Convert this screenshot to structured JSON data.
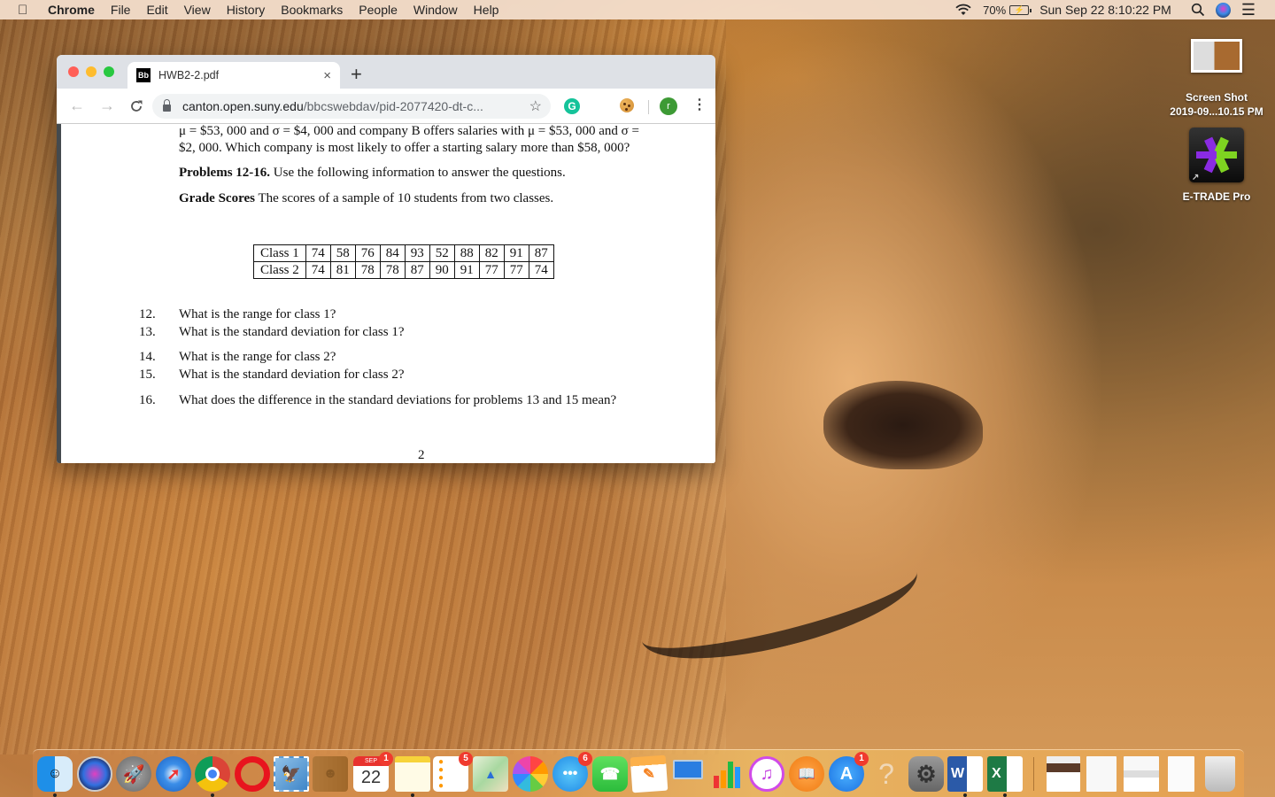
{
  "menubar": {
    "apple_icon": "apple-logo-icon",
    "app_name": "Chrome",
    "menus": [
      "File",
      "Edit",
      "View",
      "History",
      "Bookmarks",
      "People",
      "Window",
      "Help"
    ],
    "battery_percent": "70%",
    "datetime": "Sun Sep 22  8:10:22 PM",
    "status_icons": [
      "wifi-icon",
      "battery-charging-icon",
      "spotlight-search-icon",
      "siri-icon",
      "notification-center-icon"
    ]
  },
  "browser": {
    "tab": {
      "favicon_text": "Bb",
      "title": "HWB2-2.pdf",
      "close_glyph": "×"
    },
    "new_tab_glyph": "+",
    "nav": {
      "back": "←",
      "forward": "→",
      "reload": "C"
    },
    "url": {
      "host": "canton.open.suny.edu",
      "path": "/bbcswebdav/pid-2077420-dt-c..."
    },
    "bookmark_glyph": "☆",
    "extensions": [
      "grammarly-icon",
      "cookie-icon"
    ],
    "grammarly_letter": "G",
    "profile_initial": "r",
    "menu_glyph": "⋮"
  },
  "document": {
    "line1_prefix": "μ = $53, 000 and σ = $4, 000 and company B offers salaries with μ = $53, 000 and σ =",
    "line2": "$2, 000. Which company is most likely to offer a starting salary more than $58, 000?",
    "problems_heading": "Problems 12-16.",
    "problems_text": " Use the following information to answer the questions.",
    "grade_heading": "Grade Scores",
    "grade_text": " The scores of a sample of 10 students from two classes.",
    "table": {
      "rows": [
        {
          "label": "Class 1",
          "values": [
            "74",
            "58",
            "76",
            "84",
            "93",
            "52",
            "88",
            "82",
            "91",
            "87"
          ]
        },
        {
          "label": "Class 2",
          "values": [
            "74",
            "81",
            "78",
            "78",
            "87",
            "90",
            "91",
            "77",
            "77",
            "74"
          ]
        }
      ]
    },
    "questions": [
      {
        "num": "12.",
        "text": "What is the range for class 1?"
      },
      {
        "num": "13.",
        "text": "What is the standard deviation for class 1?"
      },
      {
        "num": "14.",
        "text": "What is the range for class 2?"
      },
      {
        "num": "15.",
        "text": "What is the standard deviation for class 2?"
      },
      {
        "num": "16.",
        "text": "What does the difference in the standard deviations for problems 13 and 15 mean?"
      }
    ],
    "page_number": "2"
  },
  "desktop": {
    "icons": [
      {
        "name": "screenshot-file",
        "label_line1": "Screen Shot",
        "label_line2": "2019-09...10.15 PM"
      },
      {
        "name": "etrade-pro-app",
        "label_line1": "E-TRADE Pro",
        "label_line2": ""
      }
    ]
  },
  "dock": {
    "items": [
      {
        "name": "finder",
        "running": true
      },
      {
        "name": "siri",
        "running": false
      },
      {
        "name": "launchpad",
        "running": false
      },
      {
        "name": "safari",
        "running": false
      },
      {
        "name": "chrome",
        "running": true
      },
      {
        "name": "opera",
        "running": false
      },
      {
        "name": "mail",
        "running": false
      },
      {
        "name": "contacts",
        "running": false
      },
      {
        "name": "calendar",
        "running": false,
        "badge": "1",
        "month": "SEP",
        "day": "22"
      },
      {
        "name": "notes",
        "running": true
      },
      {
        "name": "reminders",
        "running": false,
        "badge": "5"
      },
      {
        "name": "maps",
        "running": false
      },
      {
        "name": "photos",
        "running": false
      },
      {
        "name": "messages",
        "running": false,
        "badge": "6"
      },
      {
        "name": "facetime",
        "running": false
      },
      {
        "name": "pages",
        "running": false
      },
      {
        "name": "keynote",
        "running": false
      },
      {
        "name": "numbers",
        "running": false
      },
      {
        "name": "itunes",
        "running": false
      },
      {
        "name": "books",
        "running": false
      },
      {
        "name": "app-store",
        "running": false,
        "badge": "1"
      },
      {
        "name": "unknown-app",
        "running": false,
        "glyph": "?"
      },
      {
        "name": "system-preferences",
        "running": false
      },
      {
        "name": "microsoft-word",
        "running": true,
        "glyph": "W"
      },
      {
        "name": "microsoft-excel",
        "running": true,
        "glyph": "X"
      },
      {
        "name": "chrome-window-1",
        "running": false
      },
      {
        "name": "notes-window",
        "running": false
      },
      {
        "name": "chrome-window-2",
        "running": false
      },
      {
        "name": "excel-window",
        "running": false
      },
      {
        "name": "trash",
        "running": false
      }
    ]
  }
}
